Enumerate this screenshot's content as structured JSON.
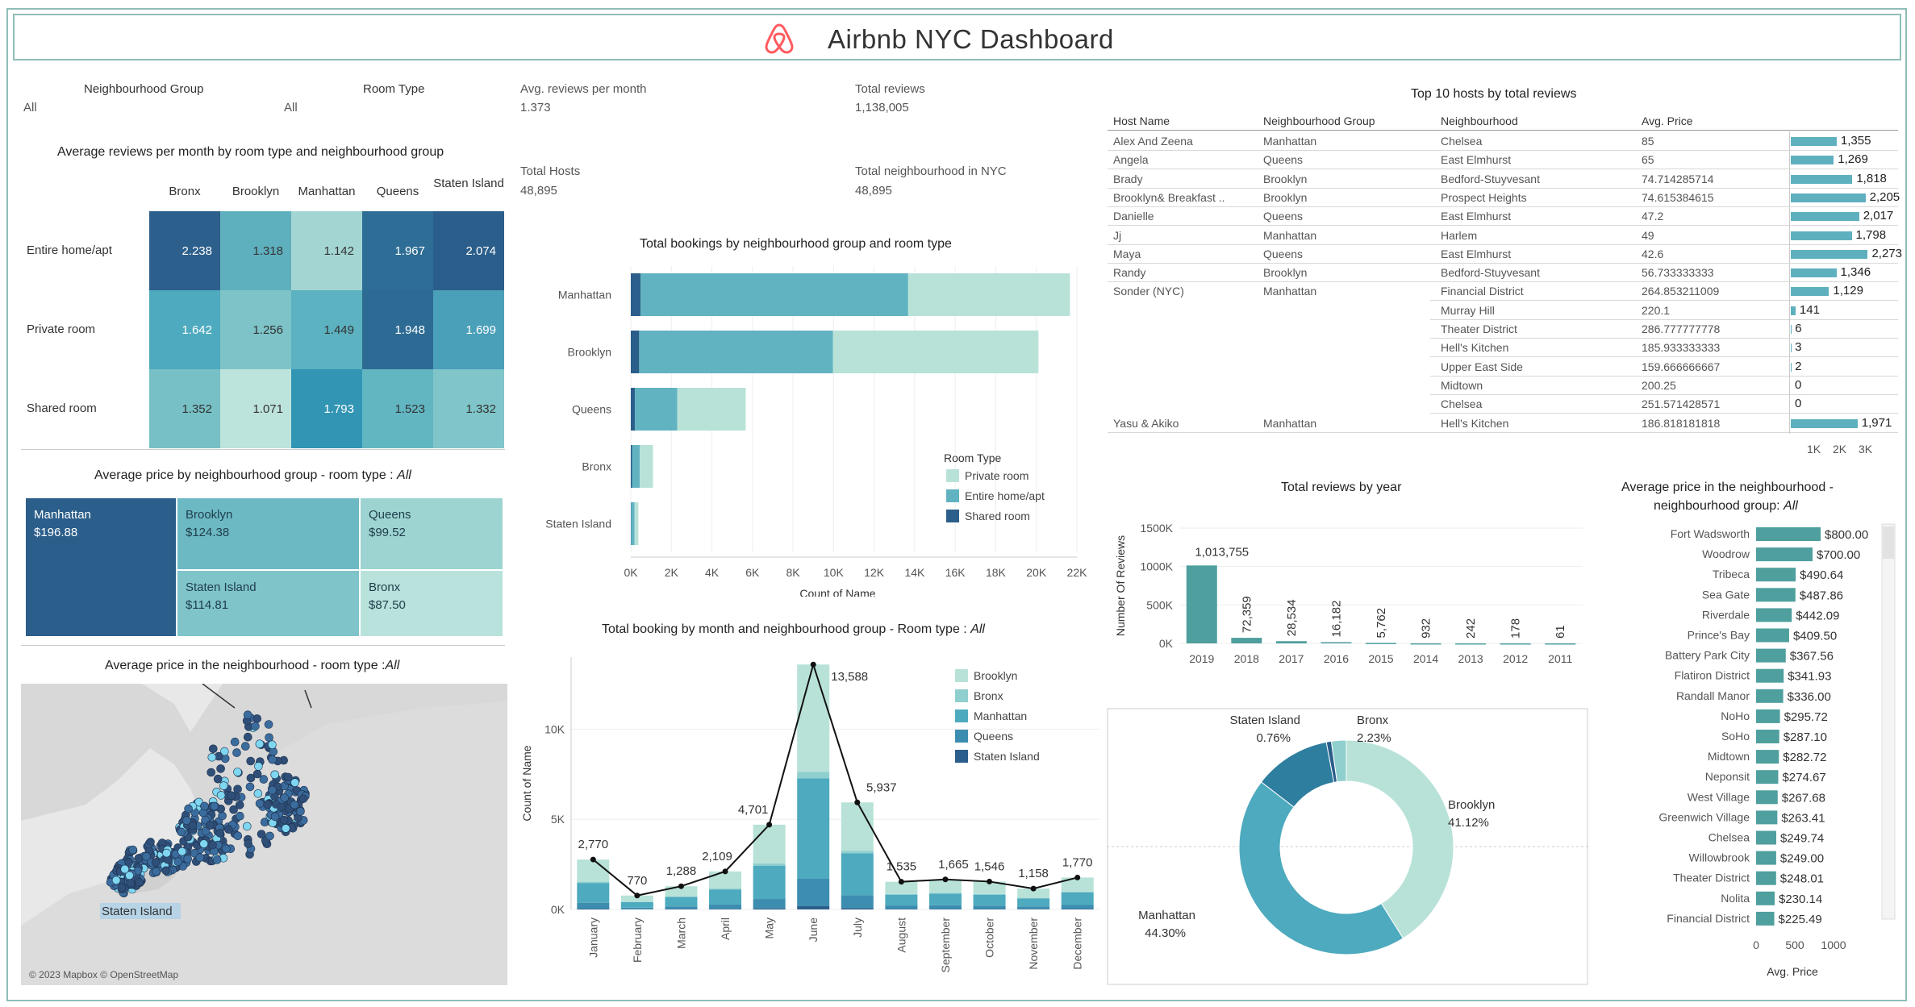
{
  "header": {
    "title": "Airbnb NYC Dashboard",
    "logo": "airbnb-logo-icon",
    "accent": "#ff5a5f"
  },
  "filters": {
    "group": {
      "label": "Neighbourhood Group",
      "value": "All"
    },
    "room": {
      "label": "Room Type",
      "value": "All"
    }
  },
  "kpis": {
    "avg_reviews": {
      "label": "Avg. reviews per month",
      "value": "1.373"
    },
    "total_reviews": {
      "label": "Total reviews",
      "value": "1,138,005"
    },
    "total_hosts": {
      "label": "Total Hosts",
      "value": "48,895"
    },
    "total_neigh": {
      "label": "Total neighbourhood in NYC",
      "value": "48,895"
    }
  },
  "heatmap": {
    "title": "Average reviews per month by room type and neighbourhood group",
    "columns": [
      "Bronx",
      "Brooklyn",
      "Manhattan",
      "Queens",
      "Staten Island"
    ],
    "rows": [
      "Entire home/apt",
      "Private room",
      "Shared room"
    ],
    "values": [
      [
        "2.238",
        "1.318",
        "1.142",
        "1.967",
        "2.074"
      ],
      [
        "1.642",
        "1.256",
        "1.449",
        "1.948",
        "1.699"
      ],
      [
        "1.352",
        "1.071",
        "1.793",
        "1.523",
        "1.332"
      ]
    ],
    "colors": [
      [
        "#2d5f8c",
        "#5fb0bf",
        "#a3d6d2",
        "#2e6d95",
        "#2b5e8a"
      ],
      [
        "#4eaabe",
        "#7dc3c8",
        "#5cb2c0",
        "#2e6b94",
        "#4a9fb9"
      ],
      [
        "#77c0c6",
        "#bde3dd",
        "#3195b3",
        "#62b6c2",
        "#7fc5c9"
      ]
    ]
  },
  "treemap": {
    "title": "Average price by neighbourhood group - room type : ",
    "title_italic": "All",
    "cells": [
      {
        "name": "Manhattan",
        "value": "$196.88",
        "color": "#2b5e8a",
        "text": "#ffffff"
      },
      {
        "name": "Brooklyn",
        "value": "$124.38",
        "color": "#6cb9c4",
        "text": "#1f3d4a"
      },
      {
        "name": "Queens",
        "value": "$99.52",
        "color": "#9dd4d1",
        "text": "#1f3d4a"
      },
      {
        "name": "Staten Island",
        "value": "$114.81",
        "color": "#7fc4c9",
        "text": "#1f3d4a"
      },
      {
        "name": "Bronx",
        "value": "$87.50",
        "color": "#b8e2db",
        "text": "#1f3d4a"
      }
    ]
  },
  "map": {
    "title": "Average price in the neighbourhood - room type :",
    "title_italic": "All",
    "label": "Staten Island",
    "credit": "© 2023 Mapbox © OpenStreetMap"
  },
  "bookings_chart": {
    "title": "Total bookings by neighbourhood group and room type",
    "xlabel": "Count of Name",
    "legend_title": "Room Type",
    "legend": [
      "Private room",
      "Entire home/apt",
      "Shared room"
    ]
  },
  "month_chart": {
    "title": "Total booking by month and neighbourhood group - Room type : ",
    "title_italic": "All",
    "ylabel": "Count of Name",
    "legend": [
      "Brooklyn",
      "Bronx",
      "Manhattan",
      "Queens",
      "Staten Island"
    ]
  },
  "hosts_table": {
    "title": "Top 10 hosts by total reviews",
    "headers": [
      "Host Name",
      "Neighbourhood Group",
      "Neighbourhood",
      "Avg. Price"
    ],
    "rows": [
      {
        "host": "Alex And Zeena",
        "group": "Manhattan",
        "neigh": "Chelsea",
        "price": "85",
        "reviews": 1355,
        "label": "1,355"
      },
      {
        "host": "Angela",
        "group": "Queens",
        "neigh": "East Elmhurst",
        "price": "65",
        "reviews": 1269,
        "label": "1,269"
      },
      {
        "host": "Brady",
        "group": "Brooklyn",
        "neigh": "Bedford-Stuyvesant",
        "price": "74.714285714",
        "reviews": 1818,
        "label": "1,818"
      },
      {
        "host": "Brooklyn& Breakfast ..",
        "group": "Brooklyn",
        "neigh": "Prospect Heights",
        "price": "74.615384615",
        "reviews": 2205,
        "label": "2,205"
      },
      {
        "host": "Danielle",
        "group": "Queens",
        "neigh": "East Elmhurst",
        "price": "47.2",
        "reviews": 2017,
        "label": "2,017"
      },
      {
        "host": "Jj",
        "group": "Manhattan",
        "neigh": "Harlem",
        "price": "49",
        "reviews": 1798,
        "label": "1,798"
      },
      {
        "host": "Maya",
        "group": "Queens",
        "neigh": "East Elmhurst",
        "price": "42.6",
        "reviews": 2273,
        "label": "2,273"
      },
      {
        "host": "Randy",
        "group": "Brooklyn",
        "neigh": "Bedford-Stuyvesant",
        "price": "56.733333333",
        "reviews": 1346,
        "label": "1,346"
      },
      {
        "host": "Sonder (NYC)",
        "group": "Manhattan",
        "neigh": "Financial District",
        "price": "264.853211009",
        "reviews": 1129,
        "label": "1,129"
      },
      {
        "host": "",
        "group": "",
        "neigh": "Murray Hill",
        "price": "220.1",
        "reviews": 141,
        "label": "141"
      },
      {
        "host": "",
        "group": "",
        "neigh": "Theater District",
        "price": "286.777777778",
        "reviews": 6,
        "label": "6"
      },
      {
        "host": "",
        "group": "",
        "neigh": "Hell's Kitchen",
        "price": "185.933333333",
        "reviews": 3,
        "label": "3"
      },
      {
        "host": "",
        "group": "",
        "neigh": "Upper East Side",
        "price": "159.666666667",
        "reviews": 2,
        "label": "2"
      },
      {
        "host": "",
        "group": "",
        "neigh": "Midtown",
        "price": "200.25",
        "reviews": 0,
        "label": "0"
      },
      {
        "host": "",
        "group": "",
        "neigh": "Chelsea",
        "price": "251.571428571",
        "reviews": 0,
        "label": "0"
      },
      {
        "host": "Yasu & Akiko",
        "group": "Manhattan",
        "neigh": "Hell's Kitchen",
        "price": "186.818181818",
        "reviews": 1971,
        "label": "1,971"
      }
    ],
    "axis_ticks": [
      "1K",
      "2K",
      "3K"
    ]
  },
  "year_chart": {
    "title": "Total reviews by year",
    "ylabel": "Number Of Reviews"
  },
  "donut": {},
  "avgprice_list": {
    "title_line1": "Average price in the neighbourhood -",
    "title_line2": "neighbourhood group: ",
    "title_italic": "All",
    "xlabel": "Avg. Price",
    "ticks": [
      "0",
      "500",
      "1000"
    ]
  },
  "chart_data": [
    {
      "type": "heatmap",
      "title": "Average reviews per month by room type and neighbourhood group",
      "x": [
        "Bronx",
        "Brooklyn",
        "Manhattan",
        "Queens",
        "Staten Island"
      ],
      "y": [
        "Entire home/apt",
        "Private room",
        "Shared room"
      ],
      "values": [
        [
          2.238,
          1.318,
          1.142,
          1.967,
          2.074
        ],
        [
          1.642,
          1.256,
          1.449,
          1.948,
          1.699
        ],
        [
          1.352,
          1.071,
          1.793,
          1.523,
          1.332
        ]
      ]
    },
    {
      "type": "bar",
      "orientation": "horizontal",
      "stacked": true,
      "title": "Total bookings by neighbourhood group and room type",
      "categories": [
        "Manhattan",
        "Brooklyn",
        "Queens",
        "Bronx",
        "Staten Island"
      ],
      "xlabel": "Count of Name",
      "xlim": [
        0,
        22000
      ],
      "xticks": [
        "0K",
        "2K",
        "4K",
        "6K",
        "8K",
        "10K",
        "12K",
        "14K",
        "16K",
        "18K",
        "20K",
        "22K"
      ],
      "series": [
        {
          "name": "Shared room",
          "values": [
            480,
            413,
            198,
            60,
            9
          ],
          "color": "#2b5e8a"
        },
        {
          "name": "Entire home/apt",
          "values": [
            13199,
            9559,
            2096,
            379,
            176
          ],
          "color": "#62b3c1"
        },
        {
          "name": "Private room",
          "values": [
            7982,
            10132,
            3372,
            652,
            188
          ],
          "color": "#b8e2d8"
        }
      ]
    },
    {
      "type": "bar",
      "stacked": true,
      "title": "Total booking by month and neighbourhood group - Room type : All",
      "categories": [
        "January",
        "February",
        "March",
        "April",
        "May",
        "June",
        "July",
        "August",
        "September",
        "October",
        "November",
        "December"
      ],
      "ylabel": "Count of Name",
      "ylim": [
        0,
        14000
      ],
      "yticks": [
        "0K",
        "5K",
        "10K"
      ],
      "totals": [
        2770,
        770,
        1288,
        2109,
        4701,
        13588,
        5937,
        1535,
        1665,
        1546,
        1158,
        1770
      ],
      "total_labels": [
        "2,770",
        "770",
        "1,288",
        "2,109",
        "4,701",
        "13,588",
        "5,937",
        "1,535",
        "1,665",
        "1,546",
        "1,158",
        "1,770"
      ],
      "series": [
        {
          "name": "Staten Island",
          "values": [
            40,
            10,
            20,
            30,
            60,
            180,
            80,
            20,
            20,
            20,
            15,
            25
          ],
          "color": "#2b5e8a"
        },
        {
          "name": "Queens",
          "values": [
            330,
            90,
            150,
            240,
            520,
            1520,
            700,
            200,
            210,
            190,
            150,
            220
          ],
          "color": "#3d8db0"
        },
        {
          "name": "Manhattan",
          "values": [
            1100,
            310,
            520,
            840,
            1850,
            5580,
            2330,
            600,
            650,
            610,
            450,
            700
          ],
          "color": "#4eaabe"
        },
        {
          "name": "Bronx",
          "values": [
            70,
            20,
            40,
            60,
            130,
            360,
            150,
            40,
            45,
            40,
            30,
            45
          ],
          "color": "#8fcfce"
        },
        {
          "name": "Brooklyn",
          "values": [
            1230,
            340,
            558,
            939,
            2141,
            5948,
            2677,
            675,
            740,
            686,
            513,
            780
          ],
          "color": "#b8e2d8"
        }
      ]
    },
    {
      "type": "bar",
      "orientation": "horizontal",
      "title": "Top 10 hosts by total reviews",
      "categories": [
        "Alex And Zeena",
        "Angela",
        "Brady",
        "Brooklyn& Breakfast ..",
        "Danielle",
        "Jj",
        "Maya",
        "Randy",
        "Sonder (NYC) - Financial District",
        "Sonder (NYC) - Murray Hill",
        "Sonder (NYC) - Theater District",
        "Sonder (NYC) - Hell's Kitchen",
        "Sonder (NYC) - Upper East Side",
        "Sonder (NYC) - Midtown",
        "Sonder (NYC) - Chelsea",
        "Yasu & Akiko"
      ],
      "values": [
        1355,
        1269,
        1818,
        2205,
        2017,
        1798,
        2273,
        1346,
        1129,
        141,
        6,
        3,
        2,
        0,
        0,
        1971
      ],
      "xticks": [
        "1K",
        "2K",
        "3K"
      ]
    },
    {
      "type": "bar",
      "title": "Total reviews by year",
      "categories": [
        "2019",
        "2018",
        "2017",
        "2016",
        "2015",
        "2014",
        "2013",
        "2012",
        "2011"
      ],
      "values": [
        1013755,
        72359,
        28534,
        16182,
        5762,
        932,
        242,
        178,
        61
      ],
      "labels": [
        "1,013,755",
        "72,359",
        "28,534",
        "16,182",
        "5,762",
        "932",
        "242",
        "178",
        "61"
      ],
      "ylabel": "Number Of Reviews",
      "ylim": [
        0,
        1500000
      ],
      "yticks": [
        "0K",
        "500K",
        "1000K",
        "1500K"
      ]
    },
    {
      "type": "pie",
      "donut": true,
      "labels": [
        "Brooklyn",
        "Manhattan",
        "Queens",
        "Staten Island",
        "Bronx"
      ],
      "values": [
        41.12,
        44.3,
        11.59,
        0.76,
        2.23
      ],
      "printed": [
        {
          "name": "Brooklyn",
          "pct": "41.12%"
        },
        {
          "name": "Manhattan",
          "pct": "44.30%"
        },
        {
          "name": "Staten Island",
          "pct": "0.76%"
        },
        {
          "name": "Bronx",
          "pct": "2.23%"
        }
      ],
      "colors": [
        "#b8e2d8",
        "#4eaabe",
        "#2e7ea0",
        "#2b5e8a",
        "#8fcfce"
      ]
    },
    {
      "type": "bar",
      "orientation": "horizontal",
      "title": "Average price in the neighbourhood - neighbourhood group: All",
      "categories": [
        "Fort Wadsworth",
        "Woodrow",
        "Tribeca",
        "Sea Gate",
        "Riverdale",
        "Prince's Bay",
        "Battery Park City",
        "Flatiron District",
        "Randall Manor",
        "NoHo",
        "SoHo",
        "Midtown",
        "Neponsit",
        "West Village",
        "Greenwich Village",
        "Chelsea",
        "Willowbrook",
        "Theater District",
        "Nolita",
        "Financial District"
      ],
      "values": [
        800.0,
        700.0,
        490.64,
        487.86,
        442.09,
        409.5,
        367.56,
        341.93,
        336.0,
        295.72,
        287.1,
        282.72,
        274.67,
        267.68,
        263.41,
        249.74,
        249.0,
        248.01,
        230.14,
        225.49
      ],
      "labels": [
        "$800.00",
        "$700.00",
        "$490.64",
        "$487.86",
        "$442.09",
        "$409.50",
        "$367.56",
        "$341.93",
        "$336.00",
        "$295.72",
        "$287.10",
        "$282.72",
        "$274.67",
        "$267.68",
        "$263.41",
        "$249.74",
        "$249.00",
        "$248.01",
        "$230.14",
        "$225.49"
      ],
      "xlabel": "Avg. Price",
      "xticks": [
        "0",
        "500",
        "1000"
      ]
    }
  ]
}
